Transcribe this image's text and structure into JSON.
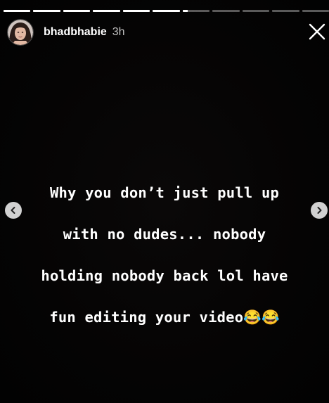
{
  "story": {
    "progress": {
      "segment_count": 11,
      "completed_segments": 6,
      "current_segment_fraction": 0.2
    },
    "header": {
      "username": "bhadbhabie",
      "timestamp": "3h"
    },
    "caption_lines": [
      "Why you don’t just pull up",
      "with no dudes... nobody",
      "holding nobody back lol have",
      "fun editing your video😂😂"
    ],
    "icons": {
      "close": "close-icon",
      "prev": "chevron-left-icon",
      "next": "chevron-right-icon"
    },
    "colors": {
      "background": "#000000",
      "text": "#ffffff",
      "nav_button": "#d9d9d9"
    }
  }
}
